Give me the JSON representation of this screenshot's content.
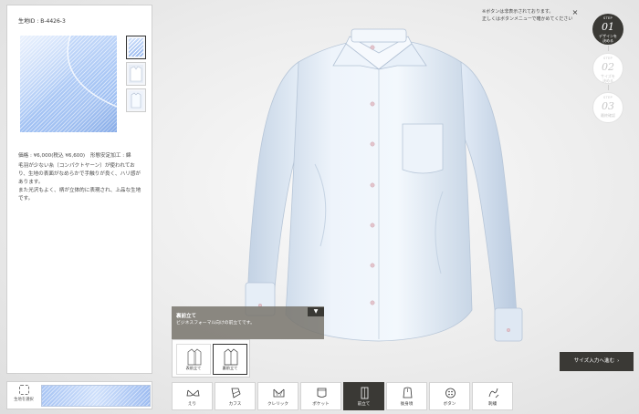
{
  "fabric": {
    "id_label": "生地ID : B-4426-3",
    "price_label": "価格 : ¥6,000(税込 ¥6,600)",
    "finish_label": "形態安定加工 : 綿",
    "description_lines": [
      "毛羽が少ない糸（コンパクトヤーン）が使われてお",
      "り、生地の表面がなめらかで手触りが良く、ハリ感が",
      "あります。",
      "また光沢もよく、柄が立体的に表現され、上品な生地",
      "です。"
    ],
    "select_label": "生地を選択"
  },
  "notice": {
    "line1": "※ボタンは非表示されております。",
    "line2": "正しくはボタンメニューで確かめてください",
    "close_symbol": "×"
  },
  "steps": [
    {
      "label": "STEP",
      "number": "01",
      "text1": "デザインを",
      "text2": "決める"
    },
    {
      "label": "STEP",
      "number": "02",
      "text1": "サイズを",
      "text2": "決める"
    },
    {
      "label": "STEP",
      "number": "03",
      "text1": "最終確認",
      "text2": ""
    }
  ],
  "option_panel": {
    "title": "裏前立て",
    "subtitle": "ビジネスフォーマル向けの前立てです。",
    "toggle_symbol": "▼",
    "cards": [
      {
        "label": "表前立て"
      },
      {
        "label": "裏前立て"
      }
    ]
  },
  "proceed_button": {
    "label": "サイズ入力へ進む",
    "arrow": "›"
  },
  "tabs": [
    {
      "label": "えり"
    },
    {
      "label": "カフス"
    },
    {
      "label": "クレリック"
    },
    {
      "label": "ポケット"
    },
    {
      "label": "前立て"
    },
    {
      "label": "後身頃"
    },
    {
      "label": "ボタン"
    },
    {
      "label": "刺繍"
    }
  ],
  "colors": {
    "accent_dark": "#3a3935",
    "fabric_blue": "#a9c7f5",
    "shirt_body": "#e8f1fa",
    "button_pink": "#d9aeb8"
  },
  "icons": [
    "collar-icon",
    "cuffs-icon",
    "cleric-icon",
    "pocket-icon",
    "placket-icon",
    "back-body-icon",
    "button-icon",
    "embroidery-icon"
  ]
}
